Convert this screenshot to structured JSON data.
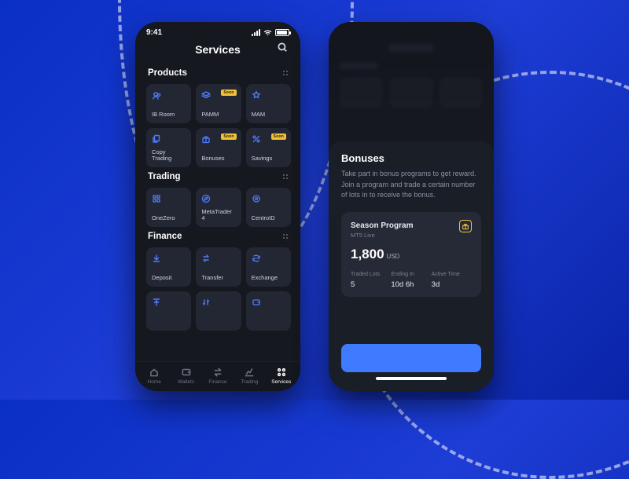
{
  "status": {
    "time": "9:41"
  },
  "screen1": {
    "title": "Services",
    "sections": {
      "products": {
        "title": "Products",
        "items": [
          {
            "name": "ib-room",
            "label": "IB Room",
            "icon": "people",
            "badge": null
          },
          {
            "name": "pamm",
            "label": "PAMM",
            "icon": "layers",
            "badge": "Soon"
          },
          {
            "name": "mam",
            "label": "MAM",
            "icon": "star",
            "badge": null
          },
          {
            "name": "copy-trading",
            "label": "Copy Trading",
            "icon": "copy",
            "badge": null
          },
          {
            "name": "bonuses",
            "label": "Bonuses",
            "icon": "gift",
            "badge": "Soon"
          },
          {
            "name": "savings",
            "label": "Savings",
            "icon": "percent",
            "badge": "Soon"
          }
        ]
      },
      "trading": {
        "title": "Trading",
        "items": [
          {
            "name": "onezero",
            "label": "OneZero",
            "icon": "grid"
          },
          {
            "name": "metatrader4",
            "label": "MetaTrader 4",
            "icon": "compass"
          },
          {
            "name": "centroid",
            "label": "CentroID",
            "icon": "target"
          }
        ]
      },
      "finance": {
        "title": "Finance",
        "items": [
          {
            "name": "deposit",
            "label": "Deposit",
            "icon": "download"
          },
          {
            "name": "transfer",
            "label": "Transfer",
            "icon": "swap"
          },
          {
            "name": "exchange",
            "label": "Exchange",
            "icon": "refresh"
          },
          {
            "name": "withdraw",
            "label": "",
            "icon": "upload"
          },
          {
            "name": "sort",
            "label": "",
            "icon": "updown"
          },
          {
            "name": "wallet",
            "label": "",
            "icon": "wallet"
          }
        ]
      }
    },
    "tabs": [
      {
        "name": "home",
        "label": "Home",
        "icon": "home"
      },
      {
        "name": "wallets",
        "label": "Wallets",
        "icon": "wallet"
      },
      {
        "name": "finance",
        "label": "Finance",
        "icon": "swap"
      },
      {
        "name": "trading",
        "label": "Trading",
        "icon": "chart"
      },
      {
        "name": "services",
        "label": "Services",
        "icon": "apps",
        "active": true
      }
    ]
  },
  "screen2": {
    "sheet": {
      "title": "Bonuses",
      "desc": "Take part in bonus programs to get reward. Join a program and trade a certain number of lots in to receive the bonus.",
      "card": {
        "name": "Season Program",
        "sub": "MT5 Live",
        "amount": "1,800",
        "unit": "USD",
        "stats": [
          {
            "label": "Traded Lots",
            "value": "5"
          },
          {
            "label": "Ending In",
            "value": "10d 6h"
          },
          {
            "label": "Active Time",
            "value": "3d"
          }
        ]
      }
    }
  },
  "colors": {
    "accent": "#3f7bff",
    "warn": "#f0c23a",
    "bg": "#15181f",
    "tile": "#232733"
  }
}
